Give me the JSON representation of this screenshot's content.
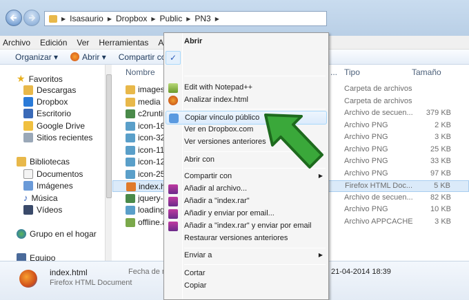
{
  "address": {
    "crumbs": [
      "Isasaurio",
      "Dropbox",
      "Public",
      "PN3"
    ]
  },
  "menubar": [
    "Archivo",
    "Edición",
    "Ver",
    "Herramientas",
    "Ayuda"
  ],
  "toolbar": {
    "organize": "Organizar ▾",
    "open": "Abrir ▾",
    "share": "Compartir co"
  },
  "nav": {
    "favorites": "Favoritos",
    "items_fav": [
      "Descargas",
      "Dropbox",
      "Escritorio",
      "Google Drive",
      "Sitios recientes"
    ],
    "libraries": "Bibliotecas",
    "items_lib": [
      "Documentos",
      "Imágenes",
      "Música",
      "Vídeos"
    ],
    "homegroup": "Grupo en el hogar",
    "computer": "Equipo"
  },
  "columns": {
    "name": "Nombre",
    "type": "Tipo",
    "size": "Tamaño",
    "dots": "..."
  },
  "files": [
    {
      "name": "images",
      "type": "Carpeta de archivos",
      "size": "",
      "color": "#e8b84a"
    },
    {
      "name": "media",
      "type": "Carpeta de archivos",
      "size": "",
      "color": "#e8b84a"
    },
    {
      "name": "c2runtim",
      "type": "Archivo de secuen...",
      "size": "379 KB",
      "color": "#4a8a4a"
    },
    {
      "name": "icon-16.",
      "type": "Archivo PNG",
      "size": "2 KB",
      "color": "#5a9fc9"
    },
    {
      "name": "icon-32.",
      "type": "Archivo PNG",
      "size": "3 KB",
      "color": "#5a9fc9"
    },
    {
      "name": "icon-114",
      "type": "Archivo PNG",
      "size": "25 KB",
      "color": "#5a9fc9"
    },
    {
      "name": "icon-128",
      "type": "Archivo PNG",
      "size": "33 KB",
      "color": "#5a9fc9"
    },
    {
      "name": "icon-256",
      "type": "Archivo PNG",
      "size": "97 KB",
      "color": "#5a9fc9"
    },
    {
      "name": "index.htr",
      "type": "Firefox HTML Doc...",
      "size": "5 KB",
      "color": "#e07a2a"
    },
    {
      "name": "jquery-2",
      "type": "Archivo de secuen...",
      "size": "82 KB",
      "color": "#4a8a4a"
    },
    {
      "name": "loading-",
      "type": "Archivo PNG",
      "size": "10 KB",
      "color": "#5a9fc9"
    },
    {
      "name": "offline.ap",
      "type": "Archivo APPCACHE",
      "size": "3 KB",
      "color": "#7aa84a"
    }
  ],
  "details": {
    "filename": "index.html",
    "filetype": "Firefox HTML Document",
    "date_label": "Fecha de m",
    "date_value": "21-04-2014 18:39"
  },
  "context_menu": [
    {
      "label": "Abrir",
      "bold": true
    },
    {
      "label": "✓",
      "check": true
    },
    {
      "label": "Edit with Notepad++"
    },
    {
      "label": "Analizar index.html"
    },
    {
      "label": "Copiar vínculo público"
    },
    {
      "label": "Ver en Dropbox.com"
    },
    {
      "label": "Ver versiones anteriores"
    },
    {
      "label": "Abrir con"
    },
    {
      "label": "Compartir con"
    },
    {
      "label": "Añadir al archivo..."
    },
    {
      "label": "Añadir a \"index.rar\""
    },
    {
      "label": "Añadir y enviar por email..."
    },
    {
      "label": "Añadir a \"index.rar\" y enviar por email"
    },
    {
      "label": "Restaurar versiones anteriores"
    },
    {
      "label": "Enviar a"
    },
    {
      "label": "Cortar"
    },
    {
      "label": "Copiar"
    }
  ],
  "colors": {
    "highlight_arrow": "#3aa83a",
    "selection": "#dbeaf9"
  }
}
